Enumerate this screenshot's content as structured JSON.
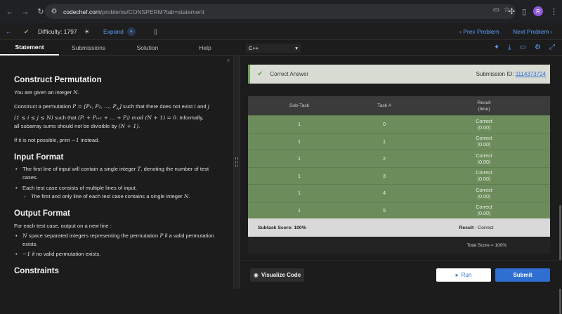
{
  "browser": {
    "url_host": "codechef.com",
    "url_path": "/problems/CONSPERM?tab=statement",
    "avatar_letter": "R"
  },
  "topbar": {
    "difficulty": "Difficulty: 1797",
    "expand": "Expand",
    "prev": "Prev Problem",
    "next": "Next Problem"
  },
  "tabs": [
    "Statement",
    "Submissions",
    "Solution",
    "Help"
  ],
  "language": "C++",
  "statement": {
    "title": "Construct Permutation",
    "intro_pre": "You are given an integer ",
    "intro_var": "N",
    "intro_post": ".",
    "p1_a": "Construct a permutation ",
    "p1_math1": "P = [P₁, P₂, ..., P",
    "p1_math1_sub": "N",
    "p1_math1_end": "]",
    "p1_b": " such that there does not exist ",
    "p1_i": "i",
    "p1_and": " and ",
    "p1_j": "j",
    "p1_line2_math": "(1 ≤ i ≤ j ≤ N)",
    "p1_line2_a": " such that ",
    "p1_line2_math2": "(Pᵢ + Pᵢ₊₁ + ... + Pⱼ)  mod  (N + 1) = 0",
    "p1_line2_b": ". Informally,",
    "p1_line3_a": "all subarray sums should not be divisible by ",
    "p1_line3_math": "(N + 1)",
    "p1_line3_b": ".",
    "p2_a": "If it is not possible, print ",
    "p2_math": "−1",
    "p2_b": " instead.",
    "input_title": "Input Format",
    "input_b1_a": "The first line of input will contain a single integer ",
    "input_b1_var": "T",
    "input_b1_b": ", denoting the number of test",
    "input_b1_c": "cases.",
    "input_b2": "Each test case consists of multiple lines of input.",
    "input_b3_a": "The first and only line of each test case contains a single integer ",
    "input_b3_var": "N",
    "input_b3_b": ".",
    "output_title": "Output Format",
    "output_p": "For each test case, output on a new line :",
    "output_b1_var": "N",
    "output_b1_a": " space separated integers representing the permutation ",
    "output_b1_var2": "P",
    "output_b1_b": " if a valid permutation",
    "output_b1_c": "exists.",
    "output_b2_math": "−1",
    "output_b2_a": " if no valid permutation exists.",
    "constraints_title": "Constraints"
  },
  "result": {
    "status": "Correct Answer",
    "submission_label": "Submission ID: ",
    "submission_id": "1114373724",
    "headers": {
      "subtask": "Sub-Task",
      "task": "Task #",
      "result_l1": "Result",
      "result_l2": "(time)"
    },
    "rows": [
      {
        "subtask": "1",
        "task": "0",
        "result": "Correct",
        "time": "(0.00)"
      },
      {
        "subtask": "1",
        "task": "1",
        "result": "Correct",
        "time": "(0.00)"
      },
      {
        "subtask": "1",
        "task": "2",
        "result": "Correct",
        "time": "(0.00)"
      },
      {
        "subtask": "1",
        "task": "3",
        "result": "Correct",
        "time": "(0.00)"
      },
      {
        "subtask": "1",
        "task": "4",
        "result": "Correct",
        "time": "(0.00)"
      },
      {
        "subtask": "1",
        "task": "5",
        "result": "Correct",
        "time": "(0.00)"
      }
    ],
    "subtask_score": "Subtask Score: 100%",
    "result_label": "Result",
    "result_value": " - Correct",
    "total_score": "Total Score = 100%"
  },
  "actions": {
    "visualize": "Visualize Code",
    "run": "Run",
    "submit": "Submit"
  },
  "colors": {
    "accent": "#2f6fd1",
    "success_row": "#6d8c5c",
    "success_bar": "#d8dcd3"
  }
}
